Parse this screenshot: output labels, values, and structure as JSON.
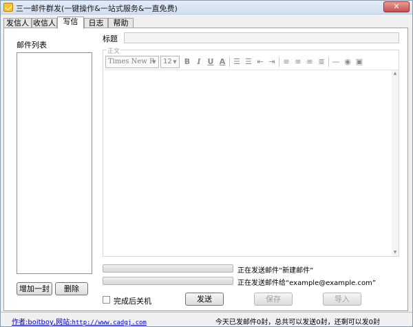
{
  "window": {
    "title": "三一邮件群发(一键操作&一站式服务&一直免费)",
    "close_glyph": "✕"
  },
  "tabs": [
    {
      "label": "发信人",
      "active": false
    },
    {
      "label": "收信人",
      "active": false
    },
    {
      "label": "写信",
      "active": true
    },
    {
      "label": "日志",
      "active": false
    },
    {
      "label": "帮助",
      "active": false
    }
  ],
  "mail_list": {
    "label": "邮件列表",
    "add_button": "增加一封",
    "delete_button": "删除"
  },
  "compose": {
    "subject_label": "标题",
    "subject_value": "",
    "body_legend": "正文",
    "font_name": "Times New R",
    "font_size": "12",
    "toolbar_icons": [
      "bold-icon",
      "italic-icon",
      "underline-icon",
      "font-color-icon",
      "ordered-list-icon",
      "unordered-list-icon",
      "outdent-icon",
      "indent-icon",
      "align-left-icon",
      "align-center-icon",
      "align-right-icon",
      "justify-icon",
      "horizontal-rule-icon",
      "insert-link-icon",
      "insert-image-icon"
    ]
  },
  "status": {
    "line1": "正在发送邮件“新建邮件”",
    "line2": "正在发送邮件给“example@example.com”",
    "progress1": 0,
    "progress2": 0
  },
  "actions": {
    "shutdown_label": "完成后关机",
    "shutdown_checked": false,
    "send": "发送",
    "save": "保存",
    "import": "导入"
  },
  "statusbar": {
    "author_prefix": "作者:boitboy,网站:",
    "author_url": "http://www.cadgj.com",
    "stats": "今天已发邮件0封，总共可以发送0封，还剩可以发0封"
  }
}
